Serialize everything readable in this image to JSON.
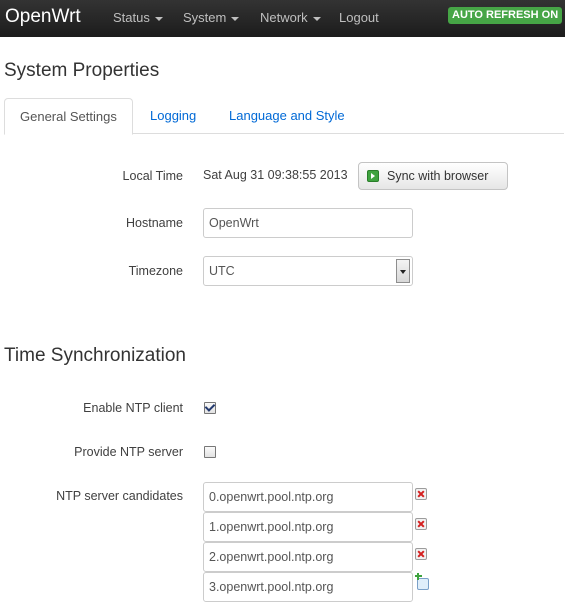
{
  "header": {
    "brand": "OpenWrt",
    "menu": [
      {
        "label": "Status",
        "dropdown": true
      },
      {
        "label": "System",
        "dropdown": true
      },
      {
        "label": "Network",
        "dropdown": true
      },
      {
        "label": "Logout",
        "dropdown": false
      }
    ],
    "auto_refresh_label": "AUTO REFRESH ON"
  },
  "page": {
    "title": "System Properties",
    "tabs": [
      {
        "label": "General Settings",
        "active": true
      },
      {
        "label": "Logging",
        "active": false
      },
      {
        "label": "Language and Style",
        "active": false
      }
    ]
  },
  "general": {
    "local_time_label": "Local Time",
    "local_time_value": "Sat Aug 31 09:38:55 2013",
    "sync_button_label": "Sync with browser",
    "hostname_label": "Hostname",
    "hostname_value": "OpenWrt",
    "timezone_label": "Timezone",
    "timezone_value": "UTC"
  },
  "time_sync": {
    "title": "Time Synchronization",
    "enable_ntp_label": "Enable NTP client",
    "enable_ntp_checked": true,
    "provide_ntp_label": "Provide NTP server",
    "provide_ntp_checked": false,
    "ntp_candidates_label": "NTP server candidates",
    "ntp_servers": [
      {
        "value": "0.openwrt.pool.ntp.org",
        "action_icon": "remove-icon"
      },
      {
        "value": "1.openwrt.pool.ntp.org",
        "action_icon": "remove-icon"
      },
      {
        "value": "2.openwrt.pool.ntp.org",
        "action_icon": "remove-icon"
      },
      {
        "value": "3.openwrt.pool.ntp.org",
        "action_icon": "add-icon"
      }
    ]
  },
  "colors": {
    "navbar_bg": "#222222",
    "auto_refresh_bg": "#46a546",
    "link": "#0069d6"
  }
}
